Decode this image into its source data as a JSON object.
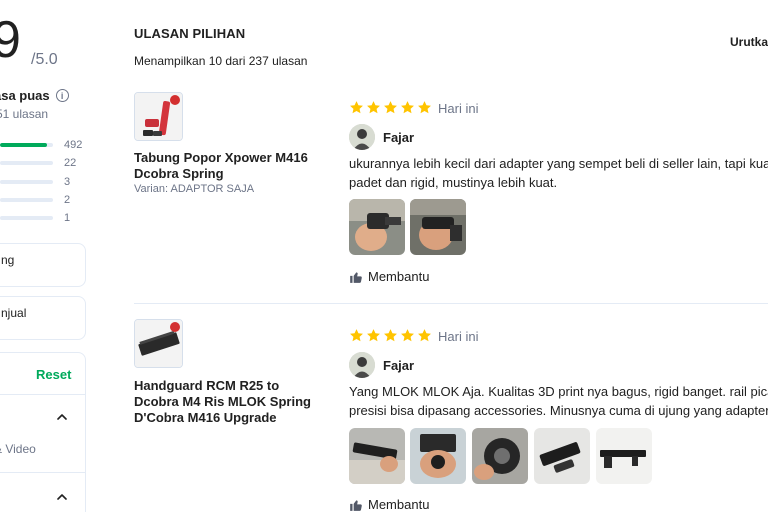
{
  "summary": {
    "rating": "9",
    "rating_max": "/5.0",
    "satisfied_label": "asa puas",
    "reviews_count": "51 ulasan",
    "bars": [
      {
        "count": "492",
        "fill": 0.88
      },
      {
        "count": "22",
        "fill": 0.0
      },
      {
        "count": "3",
        "fill": 0.0
      },
      {
        "count": "2",
        "fill": 0.0
      },
      {
        "count": "1",
        "fill": 0.0
      }
    ]
  },
  "filters": {
    "card1_label": "ng",
    "card2_label": "njual",
    "reset_label": "Reset",
    "media_label": "& Video"
  },
  "header": {
    "title": "ULASAN PILIHAN",
    "showing": "Menampilkan 10 dari 237 ulasan",
    "sort_label": "Urutkan"
  },
  "reviews": [
    {
      "product_name": "Tabung Popor Xpower M416 Dcobra Spring",
      "variant": "Varian: ADAPTOR SAJA",
      "stars": 5,
      "date": "Hari ini",
      "user": "Fajar",
      "text_line1": "ukurannya lebih kecil dari adapter yang sempet beli di seller lain, tapi kualitas",
      "text_line2": "padet dan rigid, mustinya lebih kuat.",
      "helpful_label": "Membantu"
    },
    {
      "product_name": "Handguard RCM R25 to Dcobra M4 Ris MLOK Spring D'Cobra M416 Upgrade",
      "variant": "",
      "stars": 5,
      "date": "Hari ini",
      "user": "Fajar",
      "text_line1": "Yang MLOK MLOK Aja. Kualitas 3D print nya bagus, rigid banget. rail picatinny",
      "text_line2": "presisi bisa dipasang accessories. Minusnya cuma di ujung yang adapter",
      "helpful_label": "Membantu"
    }
  ],
  "colors": {
    "accent_green": "#00aa5b",
    "star_yellow": "#ffc400",
    "muted_text": "#6d7588"
  }
}
